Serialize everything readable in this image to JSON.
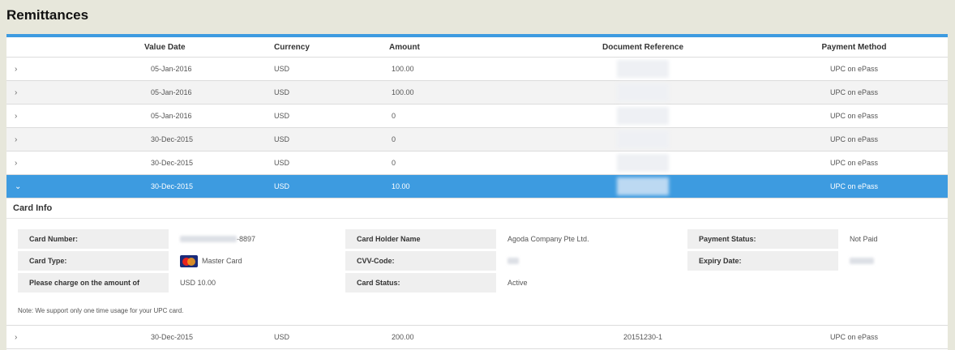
{
  "page_title": "Remittances",
  "table": {
    "headers": [
      "Value Date",
      "Currency",
      "Amount",
      "Document Reference",
      "Payment Method"
    ],
    "rows": [
      {
        "date": "05-Jan-2016",
        "currency": "USD",
        "amount": "100.00",
        "method": "UPC on ePass"
      },
      {
        "date": "05-Jan-2016",
        "currency": "USD",
        "amount": "100.00",
        "method": "UPC on ePass"
      },
      {
        "date": "05-Jan-2016",
        "currency": "USD",
        "amount": "0",
        "method": "UPC on ePass"
      },
      {
        "date": "30-Dec-2015",
        "currency": "USD",
        "amount": "0",
        "method": "UPC on ePass"
      },
      {
        "date": "30-Dec-2015",
        "currency": "USD",
        "amount": "0",
        "method": "UPC on ePass"
      },
      {
        "date": "30-Dec-2015",
        "currency": "USD",
        "amount": "10.00",
        "method": "UPC on ePass"
      },
      {
        "date": "30-Dec-2015",
        "currency": "USD",
        "amount": "200.00",
        "reference": "20151230-1",
        "method": "UPC on ePass"
      }
    ],
    "collapsed_icon": "›",
    "expanded_icon": "⌄"
  },
  "card_info": {
    "title": "Card Info",
    "card_number_label": "Card Number:",
    "card_number_suffix": "-8897",
    "card_holder_label": "Card Holder Name",
    "card_holder_value": "Agoda Company Pte Ltd.",
    "payment_status_label": "Payment Status:",
    "payment_status_value": "Not Paid",
    "card_type_label": "Card Type:",
    "card_type_value": "Master Card",
    "card_type_icon": "mastercard-logo",
    "cvv_label": "CVV-Code:",
    "expiry_label": "Expiry Date:",
    "charge_label": "Please charge on the amount of",
    "charge_value": "USD 10.00",
    "card_status_label": "Card Status:",
    "card_status_value": "Active",
    "note": "Note: We support only one time usage for your UPC card."
  },
  "colors": {
    "accent": "#3d9be0",
    "background": "#e7e7db"
  }
}
